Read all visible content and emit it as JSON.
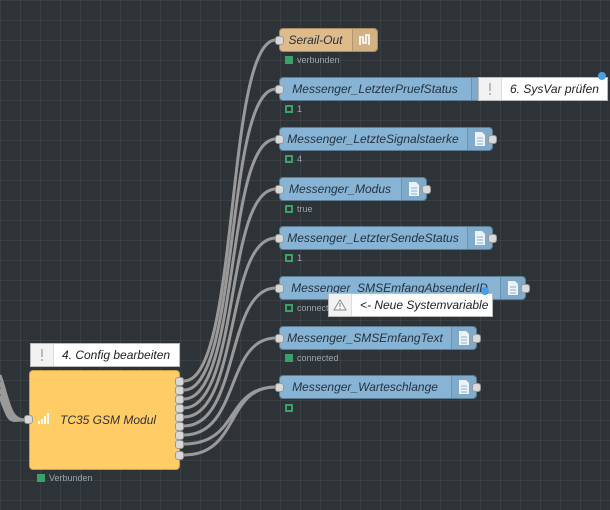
{
  "gsm_node": {
    "label": "TC35 GSM Modul",
    "status": "Verbunden",
    "icon": "signal-bars-icon"
  },
  "nodes": [
    {
      "label": "Serail-Out",
      "status": "verbunden",
      "icon": "serial-port-icon"
    },
    {
      "label": "Messenger_LetzterPruefStatus",
      "status": "1",
      "icon": "file-icon"
    },
    {
      "label": "Messenger_LetzteSignalstaerke",
      "status": "4",
      "icon": "file-icon"
    },
    {
      "label": "Messenger_Modus",
      "status": "true",
      "icon": "file-icon"
    },
    {
      "label": "Messenger_LetzterSendeStatus",
      "status": "1",
      "icon": "file-icon"
    },
    {
      "label": "Messenger_SMSEmfangAbsenderID",
      "status": "connected",
      "icon": "file-icon"
    },
    {
      "label": "Messenger_SMSEmfangText",
      "status": "connected",
      "icon": "file-icon"
    },
    {
      "label": "Messenger_Warteschlange",
      "status": "",
      "icon": "file-icon"
    }
  ],
  "comments": [
    {
      "text": "6. SysVar prüfen",
      "icon": "exclamation-icon"
    },
    {
      "text": "<- Neue Systemvariable",
      "icon": "warning-icon"
    },
    {
      "text": "4. Config bearbeiten",
      "icon": "exclamation-icon"
    }
  ],
  "colors": {
    "workspace": "#2e3338",
    "homematic_node": "#87b4d4",
    "serial_node": "#dfbb8b",
    "gsm_node": "#ffcc66",
    "status_green": "#3ca06b",
    "wire": "#999999"
  }
}
